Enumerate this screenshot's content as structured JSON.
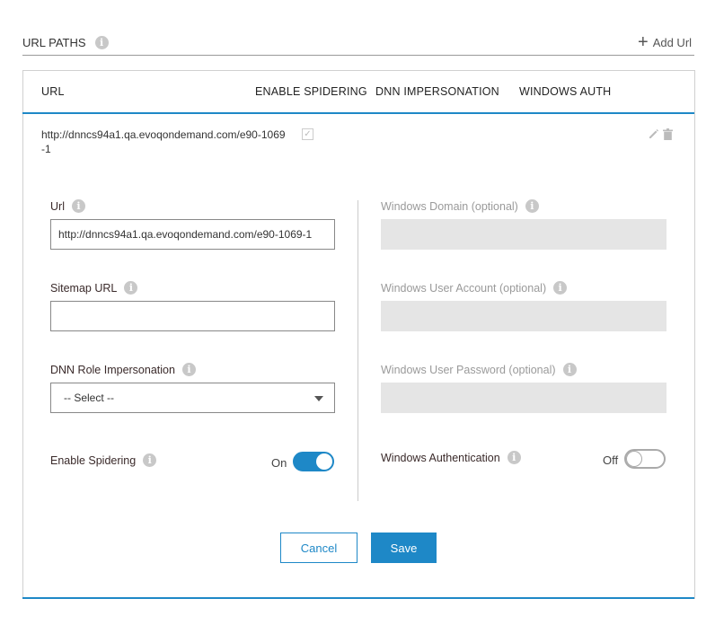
{
  "header": {
    "title": "URL PATHS",
    "add_url": "Add Url"
  },
  "table": {
    "columns": [
      "URL",
      "ENABLE SPIDERING",
      "DNN IMPERSONATION",
      "WINDOWS AUTH"
    ]
  },
  "row": {
    "url": "http://dnncs94a1.qa.evoqondemand.com/e90-1069-1",
    "spidering_checked": true
  },
  "form": {
    "url_label": "Url",
    "url_value": "http://dnncs94a1.qa.evoqondemand.com/e90-1069-1",
    "sitemap_label": "Sitemap URL",
    "sitemap_value": "",
    "role_label": "DNN Role Impersonation",
    "role_selected": "-- Select --",
    "spidering_label": "Enable Spidering",
    "spidering_state": "On",
    "win_domain_label": "Windows Domain (optional)",
    "win_account_label": "Windows User Account (optional)",
    "win_password_label": "Windows User Password (optional)",
    "win_auth_label": "Windows Authentication",
    "win_auth_state": "Off"
  },
  "buttons": {
    "cancel": "Cancel",
    "save": "Save"
  },
  "colors": {
    "accent": "#1e88c7",
    "disabled_field": "#e5e5e5"
  },
  "icons": {
    "info": "info-icon",
    "add": "plus-icon",
    "edit": "pencil-icon",
    "delete": "trash-icon"
  }
}
